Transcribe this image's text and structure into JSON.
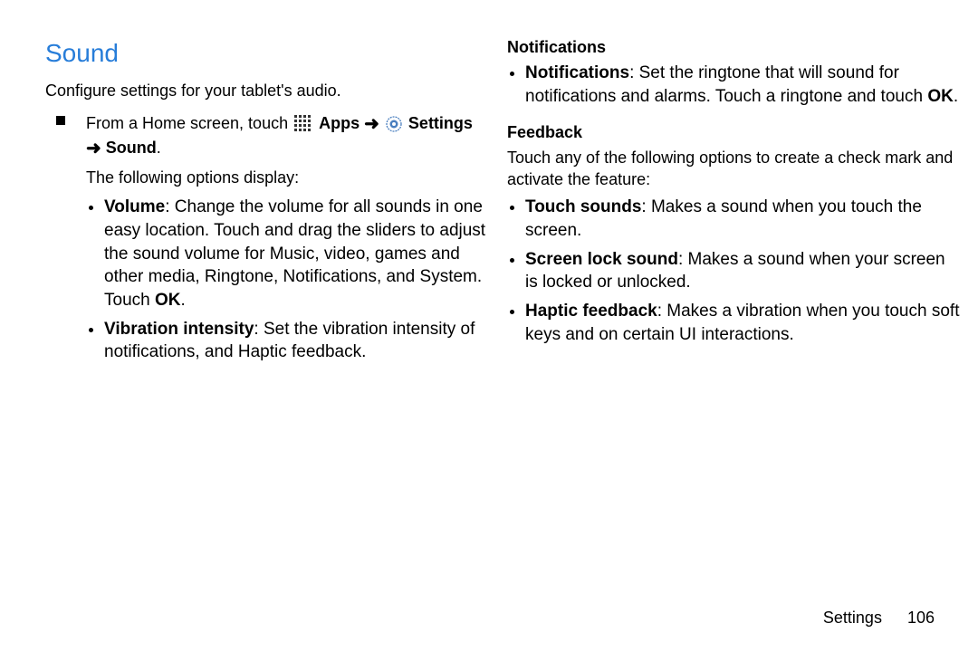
{
  "section": {
    "title": "Sound",
    "intro": "Configure settings for your tablet's audio.",
    "nav": {
      "prefix": "From a Home screen, touch ",
      "apps_label": "Apps",
      "arrow": "➜",
      "settings_label": "Settings",
      "sound_label": "Sound",
      "period": "."
    },
    "following": "The following options display:",
    "options": [
      {
        "lead": "Volume",
        "text": ": Change the volume for all sounds in one easy location. Touch and drag the sliders to adjust the sound volume for Music, video, games and other media, Ringtone, Notifications, and System. Touch ",
        "tail_bold": "OK",
        "tail": "."
      },
      {
        "lead": "Vibration intensity",
        "text": ": Set the vibration intensity of notifications, and Haptic feedback.",
        "tail_bold": "",
        "tail": ""
      }
    ]
  },
  "right": {
    "notifications": {
      "heading": "Notifications",
      "item_lead": "Notifications",
      "item_text": ": Set the ringtone that will sound for notifications and alarms. Touch a ringtone and touch ",
      "item_tail_bold": "OK",
      "item_tail": "."
    },
    "feedback": {
      "heading": "Feedback",
      "intro": "Touch any of the following options to create a check mark and activate the feature:",
      "items": [
        {
          "lead": "Touch sounds",
          "text": ": Makes a sound when you touch the screen."
        },
        {
          "lead": "Screen lock sound",
          "text": ": Makes a sound when your screen is locked or unlocked."
        },
        {
          "lead": "Haptic feedback",
          "text": ": Makes a vibration when you touch soft keys and on certain UI interactions."
        }
      ]
    }
  },
  "footer": {
    "section_name": "Settings",
    "page_number": "106"
  }
}
